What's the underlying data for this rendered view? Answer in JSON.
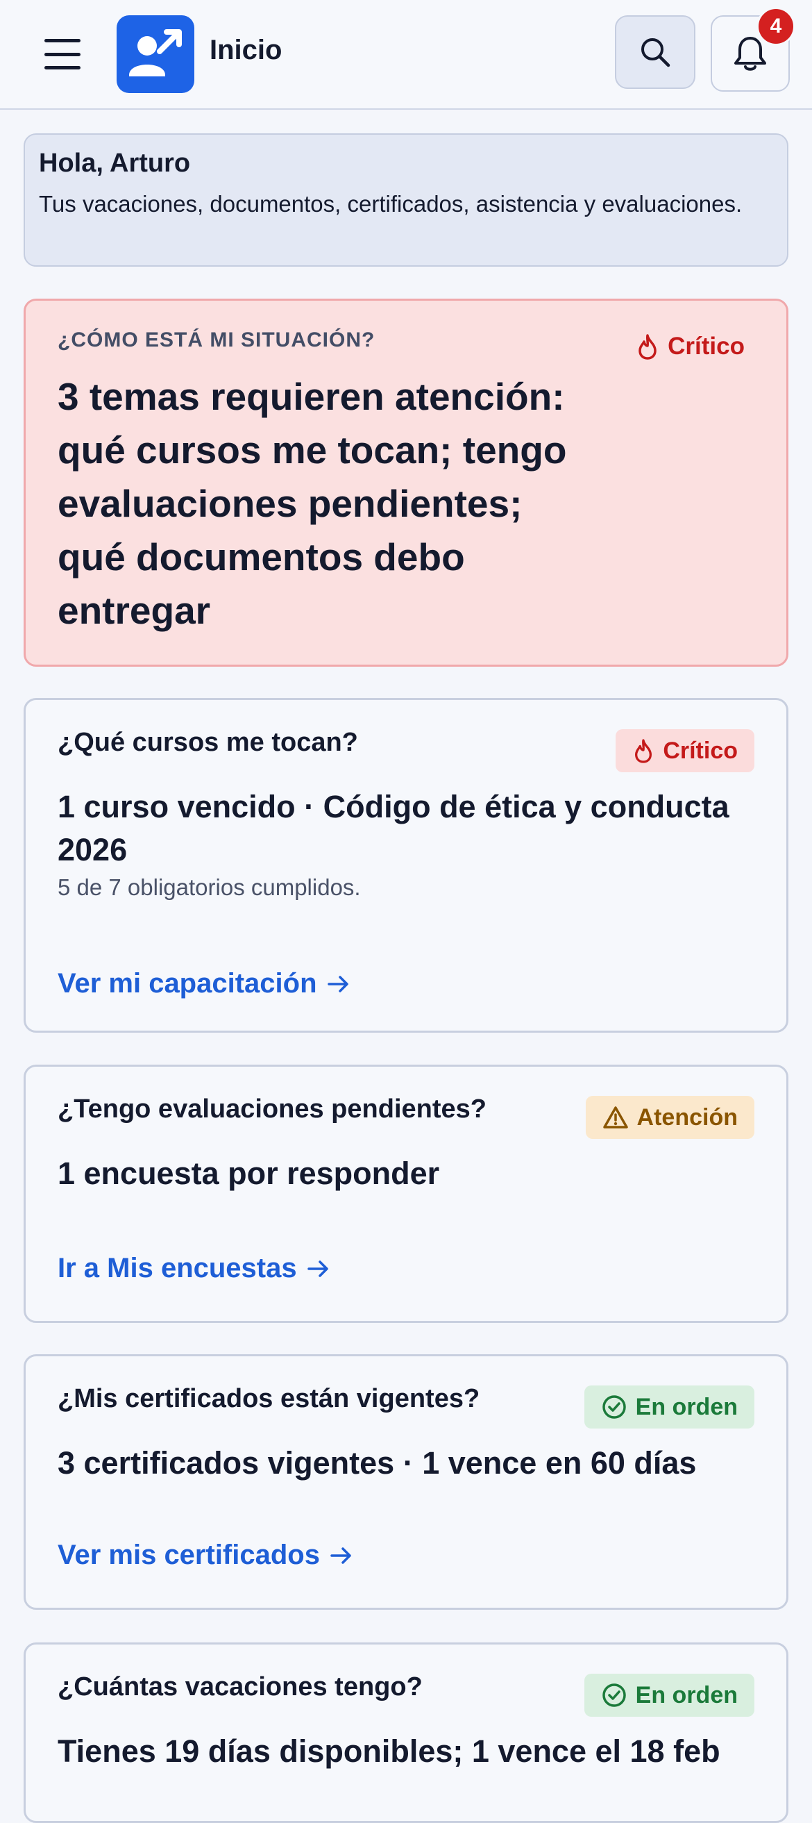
{
  "header": {
    "title": "Inicio",
    "notifications_count": "4",
    "menu_icon": "hamburger-icon",
    "logo_icon": "user-arrow-icon",
    "search_icon": "search-icon",
    "bell_icon": "bell-icon"
  },
  "greeting": {
    "title": "Hola, Arturo",
    "text": "Tus vacaciones, documentos, certificados, asistencia y evaluaciones."
  },
  "summary": {
    "eyebrow": "¿CÓMO ESTÁ MI SITUACIÓN?",
    "status": "Crítico",
    "headline": "3 temas requieren atención: qué cursos me tocan; tengo evaluaciones pendientes; qué documentos debo entregar"
  },
  "cards": [
    {
      "question": "¿Qué cursos me tocan?",
      "status": "Crítico",
      "main": "1 curso vencido · Código de ética y conducta 2026",
      "sub": "5 de 7 obligatorios cumplidos.",
      "link": "Ver mi capacitación"
    },
    {
      "question": "¿Tengo evaluaciones pendientes?",
      "status": "Atención",
      "main": "1 encuesta por responder",
      "link": "Ir a Mis encuestas"
    },
    {
      "question": "¿Mis certificados están vigentes?",
      "status": "En orden",
      "main": "3 certificados vigentes · 1 vence en 60 días",
      "link": "Ver mis certificados"
    },
    {
      "question": "¿Cuántas vacaciones tengo?",
      "status": "En orden",
      "main": "Tienes 19 días disponibles; 1 vence el 18 feb"
    }
  ],
  "colors": {
    "accent": "#1e63e6",
    "critical": "#c41a1a",
    "warning": "#8a5500",
    "ok": "#1b7a3a"
  }
}
